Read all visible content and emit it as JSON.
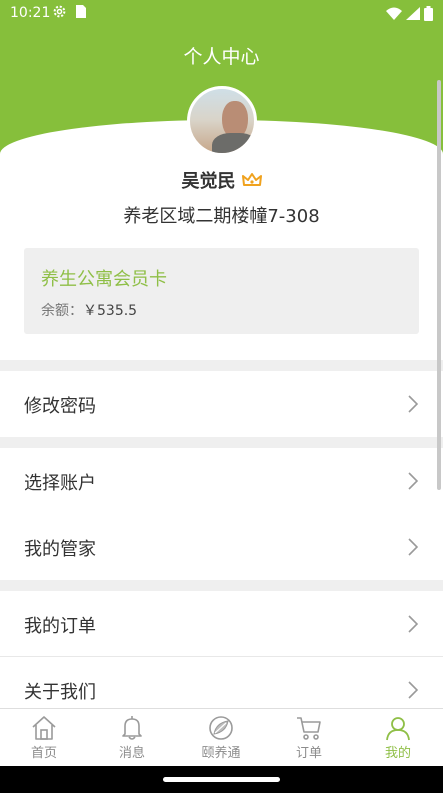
{
  "status_bar": {
    "time": "10:21"
  },
  "header": {
    "title": "个人中心"
  },
  "profile": {
    "name": "吴觉民",
    "address": "养老区域二期楼幢7-308"
  },
  "member_card": {
    "title": "养生公寓会员卡",
    "balance_label": "余额：",
    "balance_value": "￥535.5"
  },
  "menu": {
    "change_password": "修改密码",
    "select_account": "选择账户",
    "my_steward": "我的管家",
    "my_orders": "我的订单",
    "about_us": "关于我们"
  },
  "tabs": {
    "home": "首页",
    "messages": "消息",
    "yiyangtong": "颐养通",
    "orders": "订单",
    "mine": "我的"
  },
  "colors": {
    "accent": "#86bf3b",
    "accent_text": "#8fbf47",
    "crown": "#f0a21e"
  }
}
